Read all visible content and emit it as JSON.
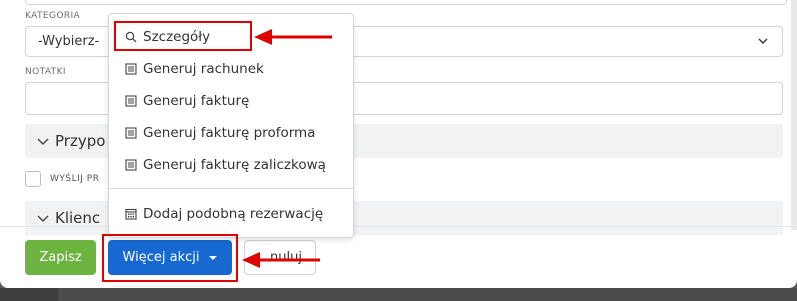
{
  "form": {
    "category_label": "KATEGORIA",
    "category_value": "-Wybierz-",
    "notes_label": "NOTATKI",
    "section_reminders": "Przypo",
    "send_label": "WYŚLIJ PR",
    "section_clients": "Klienc"
  },
  "footer": {
    "save_label": "Zapisz",
    "more_actions_label": "Więcej akcji",
    "cancel_label": "nuluj"
  },
  "dropdown": {
    "items": [
      {
        "label": "Szczegóły",
        "icon": "search-icon"
      },
      {
        "label": "Generuj rachunek",
        "icon": "document-icon"
      },
      {
        "label": "Generuj fakturę",
        "icon": "document-icon"
      },
      {
        "label": "Generuj fakturę proforma",
        "icon": "document-icon"
      },
      {
        "label": "Generuj fakturę zaliczkową",
        "icon": "document-icon"
      },
      {
        "label": "Dodaj podobną rezerwację",
        "icon": "calendar-icon"
      }
    ]
  },
  "colors": {
    "save": "#6cb33f",
    "primary": "#1769d1",
    "annotation": "#e00000"
  }
}
